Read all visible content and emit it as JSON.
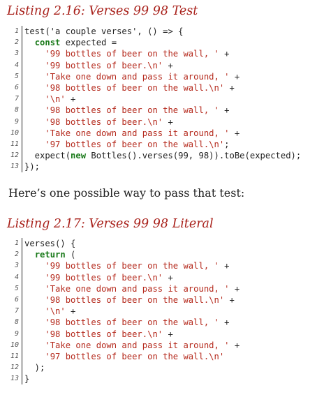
{
  "listing1": {
    "title": "Listing 2.16: Verses 99 98 Test",
    "lines": [
      {
        "n": "1",
        "segments": [
          {
            "t": "test('a couple verses', () => {",
            "c": "plain"
          }
        ]
      },
      {
        "n": "2",
        "segments": [
          {
            "t": "  ",
            "c": "plain"
          },
          {
            "t": "const",
            "c": "kw"
          },
          {
            "t": " expected =",
            "c": "plain"
          }
        ]
      },
      {
        "n": "3",
        "segments": [
          {
            "t": "    ",
            "c": "plain"
          },
          {
            "t": "'99 bottles of beer on the wall, '",
            "c": "str"
          },
          {
            "t": " +",
            "c": "plain"
          }
        ]
      },
      {
        "n": "4",
        "segments": [
          {
            "t": "    ",
            "c": "plain"
          },
          {
            "t": "'99 bottles of beer.\\n'",
            "c": "str"
          },
          {
            "t": " +",
            "c": "plain"
          }
        ]
      },
      {
        "n": "5",
        "segments": [
          {
            "t": "    ",
            "c": "plain"
          },
          {
            "t": "'Take one down and pass it around, '",
            "c": "str"
          },
          {
            "t": " +",
            "c": "plain"
          }
        ]
      },
      {
        "n": "6",
        "segments": [
          {
            "t": "    ",
            "c": "plain"
          },
          {
            "t": "'98 bottles of beer on the wall.\\n'",
            "c": "str"
          },
          {
            "t": " +",
            "c": "plain"
          }
        ]
      },
      {
        "n": "7",
        "segments": [
          {
            "t": "    ",
            "c": "plain"
          },
          {
            "t": "'\\n'",
            "c": "str"
          },
          {
            "t": " +",
            "c": "plain"
          }
        ]
      },
      {
        "n": "8",
        "segments": [
          {
            "t": "    ",
            "c": "plain"
          },
          {
            "t": "'98 bottles of beer on the wall, '",
            "c": "str"
          },
          {
            "t": " +",
            "c": "plain"
          }
        ]
      },
      {
        "n": "9",
        "segments": [
          {
            "t": "    ",
            "c": "plain"
          },
          {
            "t": "'98 bottles of beer.\\n'",
            "c": "str"
          },
          {
            "t": " +",
            "c": "plain"
          }
        ]
      },
      {
        "n": "10",
        "segments": [
          {
            "t": "    ",
            "c": "plain"
          },
          {
            "t": "'Take one down and pass it around, '",
            "c": "str"
          },
          {
            "t": " +",
            "c": "plain"
          }
        ]
      },
      {
        "n": "11",
        "segments": [
          {
            "t": "    ",
            "c": "plain"
          },
          {
            "t": "'97 bottles of beer on the wall.\\n'",
            "c": "str"
          },
          {
            "t": ";",
            "c": "plain"
          }
        ]
      },
      {
        "n": "12",
        "segments": [
          {
            "t": "  expect(",
            "c": "plain"
          },
          {
            "t": "new",
            "c": "kw"
          },
          {
            "t": " Bottles().verses(99, 98)).toBe(expected);",
            "c": "plain"
          }
        ]
      },
      {
        "n": "13",
        "segments": [
          {
            "t": "});",
            "c": "plain"
          }
        ]
      }
    ]
  },
  "prose": "Here’s one possible way to pass that test:",
  "listing2": {
    "title": "Listing 2.17: Verses 99 98 Literal",
    "lines": [
      {
        "n": "1",
        "segments": [
          {
            "t": "verses() {",
            "c": "plain"
          }
        ]
      },
      {
        "n": "2",
        "segments": [
          {
            "t": "  ",
            "c": "plain"
          },
          {
            "t": "return",
            "c": "kw"
          },
          {
            "t": " (",
            "c": "plain"
          }
        ]
      },
      {
        "n": "3",
        "segments": [
          {
            "t": "    ",
            "c": "plain"
          },
          {
            "t": "'99 bottles of beer on the wall, '",
            "c": "str"
          },
          {
            "t": " +",
            "c": "plain"
          }
        ]
      },
      {
        "n": "4",
        "segments": [
          {
            "t": "    ",
            "c": "plain"
          },
          {
            "t": "'99 bottles of beer.\\n'",
            "c": "str"
          },
          {
            "t": " +",
            "c": "plain"
          }
        ]
      },
      {
        "n": "5",
        "segments": [
          {
            "t": "    ",
            "c": "plain"
          },
          {
            "t": "'Take one down and pass it around, '",
            "c": "str"
          },
          {
            "t": " +",
            "c": "plain"
          }
        ]
      },
      {
        "n": "6",
        "segments": [
          {
            "t": "    ",
            "c": "plain"
          },
          {
            "t": "'98 bottles of beer on the wall.\\n'",
            "c": "str"
          },
          {
            "t": " +",
            "c": "plain"
          }
        ]
      },
      {
        "n": "7",
        "segments": [
          {
            "t": "    ",
            "c": "plain"
          },
          {
            "t": "'\\n'",
            "c": "str"
          },
          {
            "t": " +",
            "c": "plain"
          }
        ]
      },
      {
        "n": "8",
        "segments": [
          {
            "t": "    ",
            "c": "plain"
          },
          {
            "t": "'98 bottles of beer on the wall, '",
            "c": "str"
          },
          {
            "t": " +",
            "c": "plain"
          }
        ]
      },
      {
        "n": "9",
        "segments": [
          {
            "t": "    ",
            "c": "plain"
          },
          {
            "t": "'98 bottles of beer.\\n'",
            "c": "str"
          },
          {
            "t": " +",
            "c": "plain"
          }
        ]
      },
      {
        "n": "10",
        "segments": [
          {
            "t": "    ",
            "c": "plain"
          },
          {
            "t": "'Take one down and pass it around, '",
            "c": "str"
          },
          {
            "t": " +",
            "c": "plain"
          }
        ]
      },
      {
        "n": "11",
        "segments": [
          {
            "t": "    ",
            "c": "plain"
          },
          {
            "t": "'97 bottles of beer on the wall.\\n'",
            "c": "str"
          }
        ]
      },
      {
        "n": "12",
        "segments": [
          {
            "t": "  );",
            "c": "plain"
          }
        ]
      },
      {
        "n": "13",
        "segments": [
          {
            "t": "}",
            "c": "plain"
          }
        ]
      }
    ]
  },
  "colors": {
    "title": "#a8201a",
    "keyword": "#1a7a1a",
    "string": "#b52a1d",
    "text": "#222222"
  }
}
